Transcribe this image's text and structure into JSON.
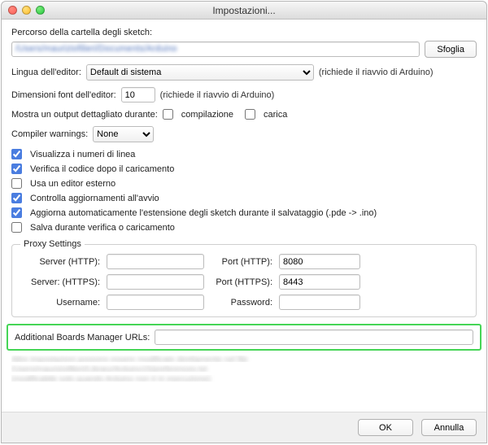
{
  "window": {
    "title": "Impostazioni..."
  },
  "sketchbook": {
    "label": "Percorso della cartella degli sketch:",
    "path": "/Users/mauriziofilieri/Documents/Arduino",
    "browse": "Sfoglia"
  },
  "language": {
    "label": "Lingua dell'editor:",
    "value": "Default di sistema",
    "hint": "(richiede il riavvio di Arduino)"
  },
  "fontsize": {
    "label": "Dimensioni font dell'editor:",
    "value": "10",
    "hint": "(richiede il riavvio di Arduino)"
  },
  "verbose": {
    "label": "Mostra un output dettagliato durante:",
    "compile_label": "compilazione",
    "compile_checked": false,
    "upload_label": "carica",
    "upload_checked": false
  },
  "warnings": {
    "label": "Compiler warnings:",
    "value": "None"
  },
  "checks": {
    "linenumbers": {
      "label": "Visualizza i numeri di linea",
      "checked": true
    },
    "verify": {
      "label": "Verifica il codice dopo il caricamento",
      "checked": true
    },
    "external": {
      "label": "Usa un editor esterno",
      "checked": false
    },
    "updates": {
      "label": "Controlla aggiornamenti all'avvio",
      "checked": true
    },
    "autoext": {
      "label": "Aggiorna automaticamente l'estensione degli sketch durante il salvataggio (.pde -> .ino)",
      "checked": true
    },
    "saveverify": {
      "label": "Salva durante verifica o caricamento",
      "checked": false
    }
  },
  "proxy": {
    "legend": "Proxy Settings",
    "server_http_label": "Server (HTTP):",
    "server_http": "",
    "port_http_label": "Port (HTTP):",
    "port_http": "8080",
    "server_https_label": "Server: (HTTPS):",
    "server_https": "",
    "port_https_label": "Port (HTTPS):",
    "port_https": "8443",
    "username_label": "Username:",
    "username": "",
    "password_label": "Password:",
    "password": ""
  },
  "boards": {
    "label": "Additional Boards Manager URLs:",
    "value": ""
  },
  "faded": {
    "l1": "Altre impostazioni possono essere modificate direttamente nel file",
    "l2": "/Users/mauriziofilieri/Library/Arduino15/preferences.txt",
    "l3": "(modificabile solo quando Arduino non è in esecuzione)"
  },
  "footer": {
    "ok": "OK",
    "cancel": "Annulla"
  }
}
